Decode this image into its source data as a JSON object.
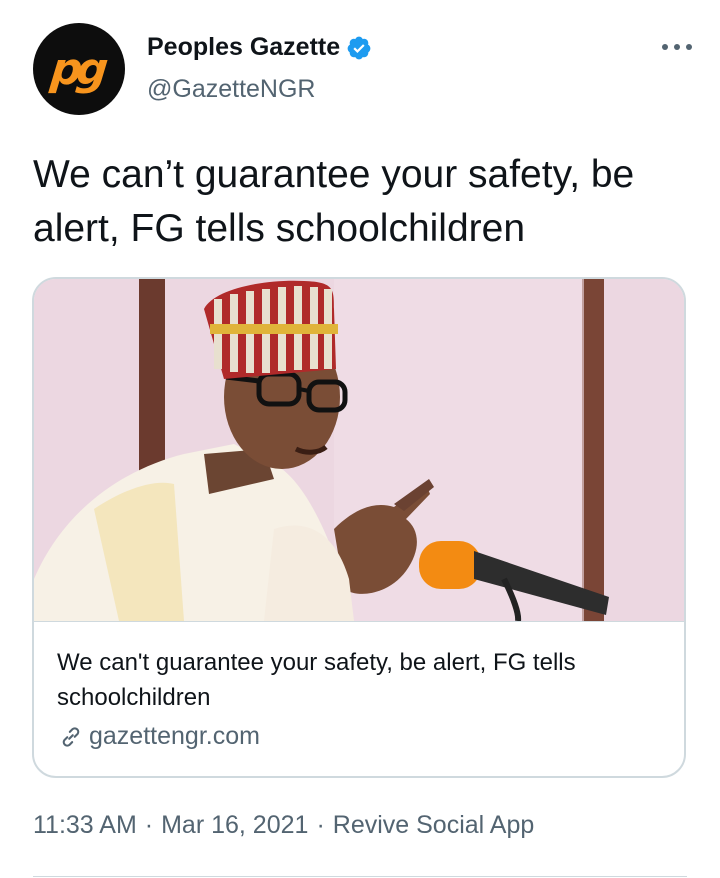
{
  "author": {
    "display_name": "Peoples Gazette",
    "handle": "@GazetteNGR",
    "avatar_icon": "pg-logo-icon",
    "verified": true,
    "verified_color": "#1d9bf0",
    "avatar_bg": "#0d0d0d",
    "avatar_mark_color": "#f7941d"
  },
  "more_menu_icon": "more-horizontal-icon",
  "tweet": {
    "text": "We can’t guarantee your safety, be alert, FG tells schoolchildren"
  },
  "link_card": {
    "image_icon": "photo-of-speaker-at-microphone",
    "title": "We can't guarantee your safety, be alert, FG tells schoolchildren",
    "domain": "gazettengr.com",
    "domain_icon": "link-icon"
  },
  "meta": {
    "time": "11:33 AM",
    "date": "Mar 16, 2021",
    "separator": "·",
    "source": "Revive Social App"
  },
  "colors": {
    "text_primary": "#0f1419",
    "text_secondary": "#536471",
    "border": "#cfd9de"
  }
}
